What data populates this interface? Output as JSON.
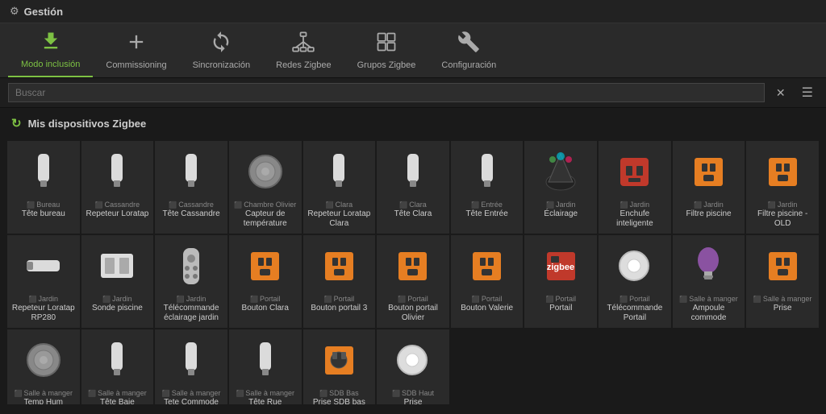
{
  "app": {
    "title": "Gestión",
    "title_icon": "⚙"
  },
  "toolbar": {
    "items": [
      {
        "id": "modo-inclusion",
        "label": "Modo inclusión",
        "icon": "⬇",
        "active": true
      },
      {
        "id": "commissioning",
        "label": "Commissioning",
        "icon": "+",
        "active": false
      },
      {
        "id": "sincronizacion",
        "label": "Sincronización",
        "icon": "↻",
        "active": false
      },
      {
        "id": "redes-zigbee",
        "label": "Redes Zigbee",
        "icon": "⬡",
        "active": false
      },
      {
        "id": "grupos-zigbee",
        "label": "Grupos Zigbee",
        "icon": "▣",
        "active": false
      },
      {
        "id": "configuracion",
        "label": "Configuración",
        "icon": "🔧",
        "active": false
      }
    ]
  },
  "search": {
    "placeholder": "Buscar",
    "close_label": "✕",
    "menu_label": "☰"
  },
  "section": {
    "title": "Mis dispositivos Zigbee",
    "icon": "↻"
  },
  "devices": [
    {
      "room": "Bureau",
      "name": "Tête bureau",
      "type": "usb-stick",
      "color": "#eee"
    },
    {
      "room": "Cassandre",
      "name": "Repeteur Loratap",
      "type": "usb-stick",
      "color": "#eee"
    },
    {
      "room": "Cassandre",
      "name": "Tête Cassandre",
      "type": "usb-stick",
      "color": "#eee"
    },
    {
      "room": "Chambre Olivier",
      "name": "Capteur de température",
      "type": "round-sensor",
      "color": "#999"
    },
    {
      "room": "Clara",
      "name": "Repeteur Loratap Clara",
      "type": "usb-stick",
      "color": "#eee"
    },
    {
      "room": "Clara",
      "name": "Tête Clara",
      "type": "usb-stick",
      "color": "#eee"
    },
    {
      "room": "Entrée",
      "name": "Tête Entrée",
      "type": "usb-stick",
      "color": "#eee"
    },
    {
      "room": "Jardin",
      "name": "Éclairage",
      "type": "spotlight",
      "color": "#333"
    },
    {
      "room": "Jardin",
      "name": "Enchufe inteligente",
      "type": "plug-box",
      "color": "#c0392b"
    },
    {
      "room": "Jardin",
      "name": "Filtre piscine",
      "type": "plug-orange",
      "color": "#e67e22"
    },
    {
      "room": "Jardin",
      "name": "Filtre piscine - OLD",
      "type": "plug-orange",
      "color": "#e67e22"
    },
    {
      "room": "Jardin",
      "name": "Repeteur Loratap RP280",
      "type": "usb-flat",
      "color": "#eee"
    },
    {
      "room": "Jardin",
      "name": "Sonde piscine",
      "type": "sensor-sq",
      "color": "#ddd"
    },
    {
      "room": "Jardin",
      "name": "Télécommande éclairage jardin",
      "type": "remote",
      "color": "#aaa"
    },
    {
      "room": "Portail",
      "name": "Bouton Clara",
      "type": "plug-orange",
      "color": "#e67e22"
    },
    {
      "room": "Portail",
      "name": "Bouton portail 3",
      "type": "plug-orange",
      "color": "#e67e22"
    },
    {
      "room": "Portail",
      "name": "Bouton portail Olivier",
      "type": "plug-orange",
      "color": "#e67e22"
    },
    {
      "room": "Portail",
      "name": "Bouton Valerie",
      "type": "plug-orange",
      "color": "#e67e22"
    },
    {
      "room": "Portail",
      "name": "Portail",
      "type": "zigbee-box",
      "color": "#c0392b"
    },
    {
      "room": "Portail",
      "name": "Télécommande Portail",
      "type": "round-white",
      "color": "#ddd"
    },
    {
      "room": "Salle à manger",
      "name": "Ampoule commode",
      "type": "bulb",
      "color": "#9b59b6"
    },
    {
      "room": "Salle à manger",
      "name": "Prise",
      "type": "plug-orange",
      "color": "#e67e22"
    },
    {
      "room": "Salle à manger",
      "name": "Temp Hum",
      "type": "round-sensor",
      "color": "#999"
    },
    {
      "room": "Salle à manger",
      "name": "Tête Baie",
      "type": "usb-stick",
      "color": "#eee"
    },
    {
      "room": "Salle à manger",
      "name": "Tete Commode",
      "type": "usb-stick",
      "color": "#eee"
    },
    {
      "room": "Salle à manger",
      "name": "Tête Rue",
      "type": "usb-stick",
      "color": "#eee"
    },
    {
      "room": "SDB Bas",
      "name": "Prise SDB bas",
      "type": "plug-zigbee",
      "color": "#e67e22"
    },
    {
      "room": "SDB Haut",
      "name": "Prise",
      "type": "round-white",
      "color": "#ddd"
    }
  ]
}
